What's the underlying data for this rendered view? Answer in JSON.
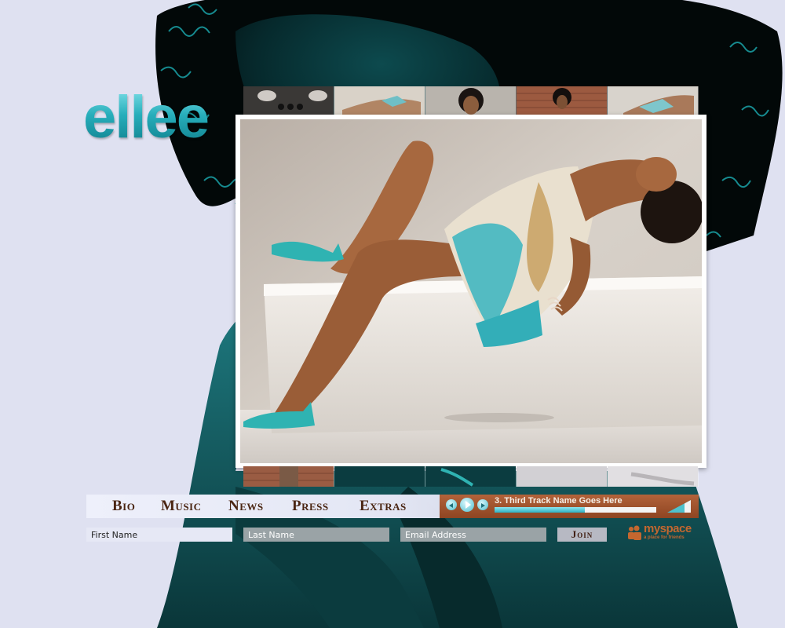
{
  "brand": {
    "logo_text": "ellee"
  },
  "nav": {
    "items": [
      {
        "label": "Bio"
      },
      {
        "label": "Music"
      },
      {
        "label": "News"
      },
      {
        "label": "Press"
      },
      {
        "label": "Extras"
      }
    ]
  },
  "player": {
    "track_title": "3. Third Track Name Goes Here",
    "progress": 0.56,
    "icons": [
      "previous-icon",
      "play-icon",
      "next-icon",
      "volume-icon"
    ]
  },
  "signup": {
    "first_name_placeholder": "First Name",
    "last_name_placeholder": "Last Name",
    "email_placeholder": "Email Address",
    "join_label": "Join"
  },
  "myspace": {
    "label": "myspace",
    "tagline": "a place for friends"
  },
  "colors": {
    "background": "#dfe1f1",
    "teal_accent": "#2ab5c2",
    "player_bg": "#a1522b",
    "nav_text": "#4a2512"
  }
}
